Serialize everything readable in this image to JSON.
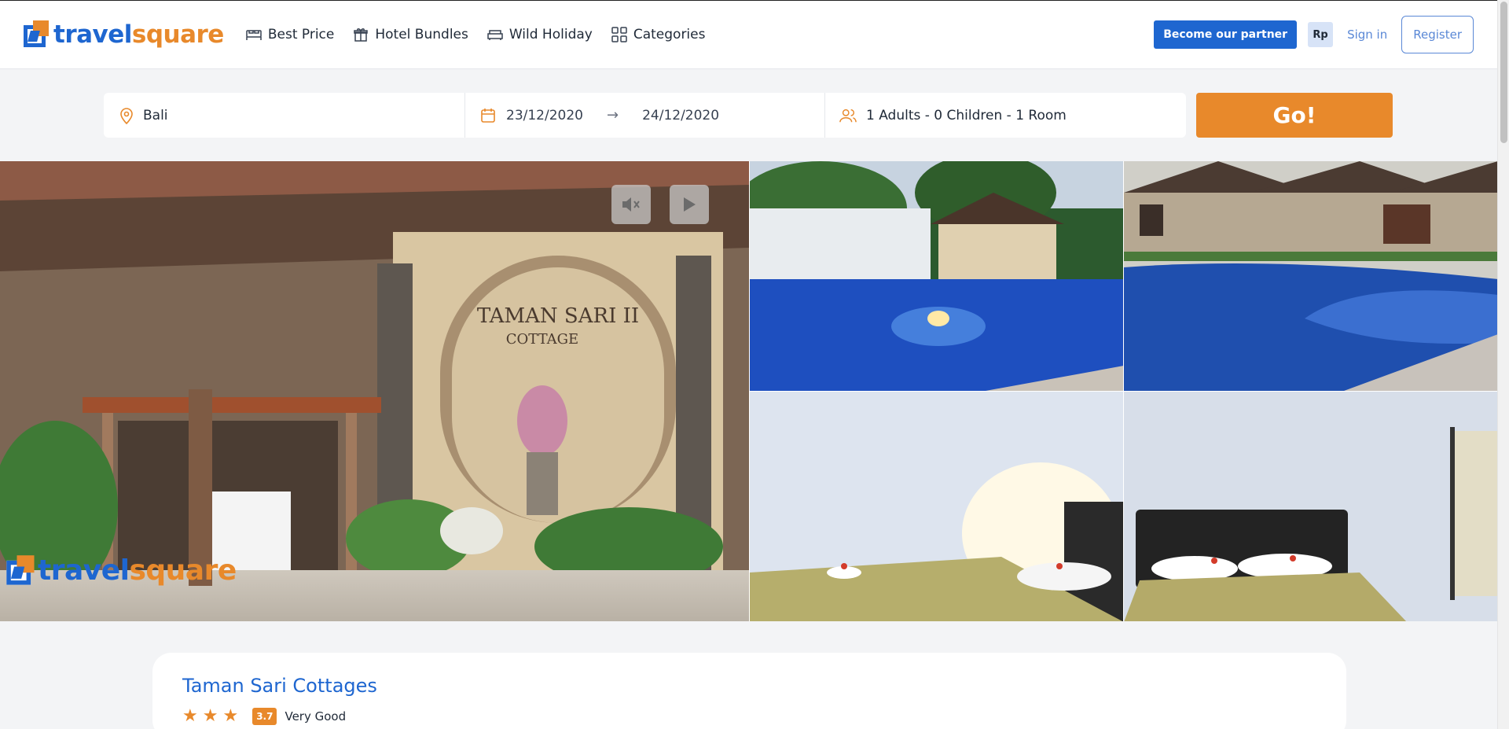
{
  "brand": {
    "name_part1": "travel",
    "name_part2": "square"
  },
  "nav": {
    "items": [
      {
        "label": "Best Price",
        "icon": "bed-icon"
      },
      {
        "label": "Hotel Bundles",
        "icon": "gift-icon"
      },
      {
        "label": "Wild Holiday",
        "icon": "sofa-icon"
      },
      {
        "label": "Categories",
        "icon": "grid-icon"
      }
    ]
  },
  "header": {
    "partner_label": "Become our partner",
    "currency_label": "Rp",
    "sign_in_label": "Sign in",
    "register_label": "Register"
  },
  "search": {
    "location": "Bali",
    "check_in": "23/12/2020",
    "check_out": "24/12/2020",
    "guests": "1 Adults - 0 Children - 1 Room",
    "go_label": "Go!"
  },
  "gallery": {
    "video_controls": [
      "mute-icon",
      "play-icon"
    ],
    "watermark_part1": "travel",
    "watermark_part2": "square"
  },
  "hotel": {
    "name": "Taman Sari Cottages",
    "stars": 3,
    "score": "3.7",
    "score_label": "Very Good"
  },
  "colors": {
    "brand_blue": "#1e66d0",
    "brand_orange": "#e8892b"
  }
}
